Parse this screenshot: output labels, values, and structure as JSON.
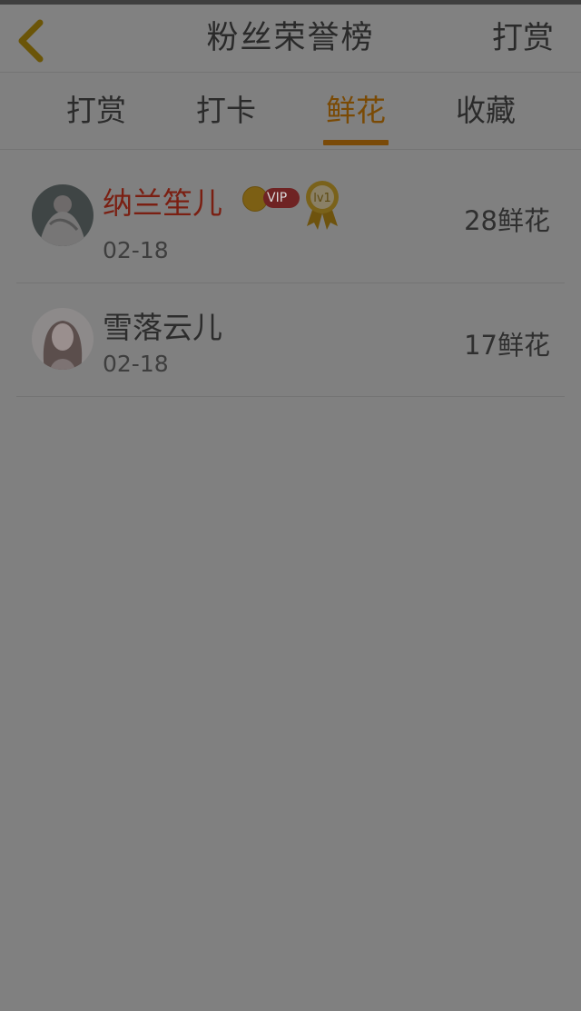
{
  "header": {
    "title": "粉丝荣誉榜",
    "action": "打赏"
  },
  "tabs": [
    {
      "label": "打赏",
      "active": false
    },
    {
      "label": "打卡",
      "active": false
    },
    {
      "label": "鲜花",
      "active": true
    },
    {
      "label": "收藏",
      "active": false
    }
  ],
  "list": [
    {
      "name": "纳兰笙儿",
      "date": "02-18",
      "count": "28鲜花",
      "vip": true,
      "vip_label": "VIP",
      "level_label": "lv1"
    },
    {
      "name": "雪落云儿",
      "date": "02-18",
      "count": "17鲜花",
      "vip": false
    }
  ],
  "colors": {
    "accent": "#7a4a05",
    "vip_name": "#7a1f12",
    "background": "#808080"
  },
  "icons": {
    "back": "chevron-left-icon",
    "vip_crown": "crown-icon",
    "level_medal": "medal-icon"
  }
}
